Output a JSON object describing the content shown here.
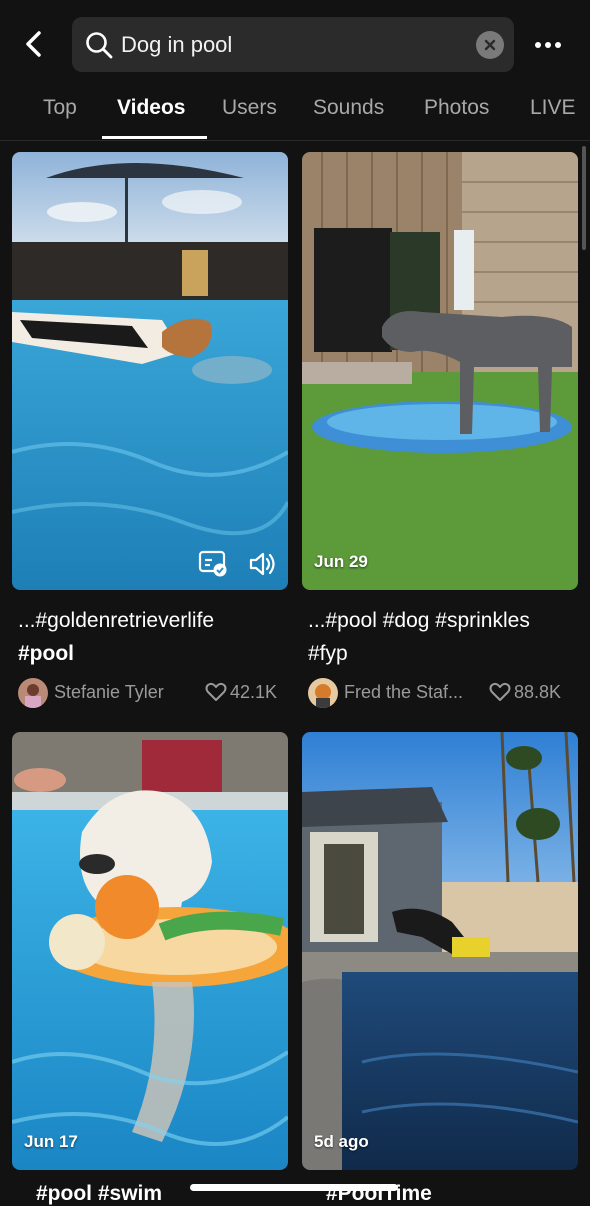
{
  "search": {
    "query": "Dog in pool"
  },
  "tabs": [
    "Top",
    "Videos",
    "Users",
    "Sounds",
    "Photos",
    "LIVE"
  ],
  "active_tab": "Videos",
  "cards": [
    {
      "date": "",
      "caption_line1": "...#goldenretrieverlife",
      "caption_line2": "#pool",
      "author": "Stefanie Tyler",
      "likes": "42.1K"
    },
    {
      "date": "Jun 29",
      "caption_line1": "...#pool #dog #sprinkles",
      "caption_line2": "#fyp",
      "author": "Fred the Staf...",
      "likes": "88.8K"
    },
    {
      "date": "Jun 17"
    },
    {
      "date": "5d ago"
    }
  ],
  "peek_captions": [
    "#pool #swim",
    "#PoolTime"
  ],
  "icons": [
    "back-arrow-icon",
    "search-icon",
    "clear-icon",
    "more-dots-icon",
    "caption-icon",
    "volume-icon",
    "heart-icon"
  ]
}
